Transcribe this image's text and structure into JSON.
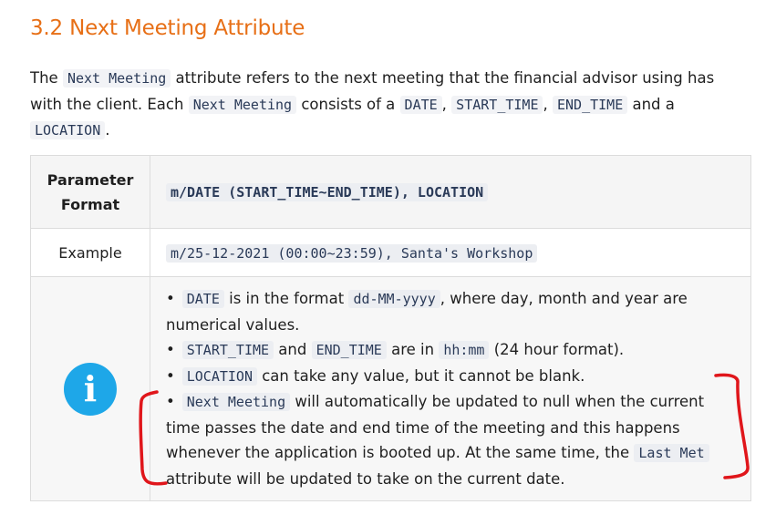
{
  "heading": "3.2 Next Meeting Attribute",
  "intro": {
    "t1": "The ",
    "c1": "Next Meeting",
    "t2": " attribute refers to the next meeting that the financial advisor using has with the client. Each ",
    "c2": "Next Meeting",
    "t3": " consists of a ",
    "c3": "DATE",
    "t4": ", ",
    "c4": "START_TIME",
    "t5": ", ",
    "c5": "END_TIME",
    "t6": " and a ",
    "c6": "LOCATION",
    "t7": "."
  },
  "table": {
    "format_label": "Parameter Format",
    "format_value": "m/DATE (START_TIME~END_TIME), LOCATION",
    "example_label": "Example",
    "example_value": "m/25-12-2021 (00:00~23:59), Santa's Workshop",
    "info_icon_glyph": "i"
  },
  "notes": [
    {
      "c1": "DATE",
      "t1": " is in the format ",
      "c2": "dd-MM-yyyy",
      "t2": ", where day, month and year are numerical values."
    },
    {
      "c1": "START_TIME",
      "t1": " and ",
      "c2": "END_TIME",
      "t2": " are in ",
      "c3": "hh:mm",
      "t3": " (24 hour format)."
    },
    {
      "c1": "LOCATION",
      "t1": " can take any value, but it cannot be blank."
    },
    {
      "c1": "Next Meeting",
      "t1": " will automatically be updated to null when the current time passes the date and end time of the meeting and this happens whenever the application is booted up. At the same time, the ",
      "c2": "Last Met",
      "t2": " attribute will be updated to take on the current date."
    }
  ],
  "colors": {
    "heading": "#e76f16",
    "info_icon": "#1ea7e8",
    "annotation": "#e0161b"
  }
}
